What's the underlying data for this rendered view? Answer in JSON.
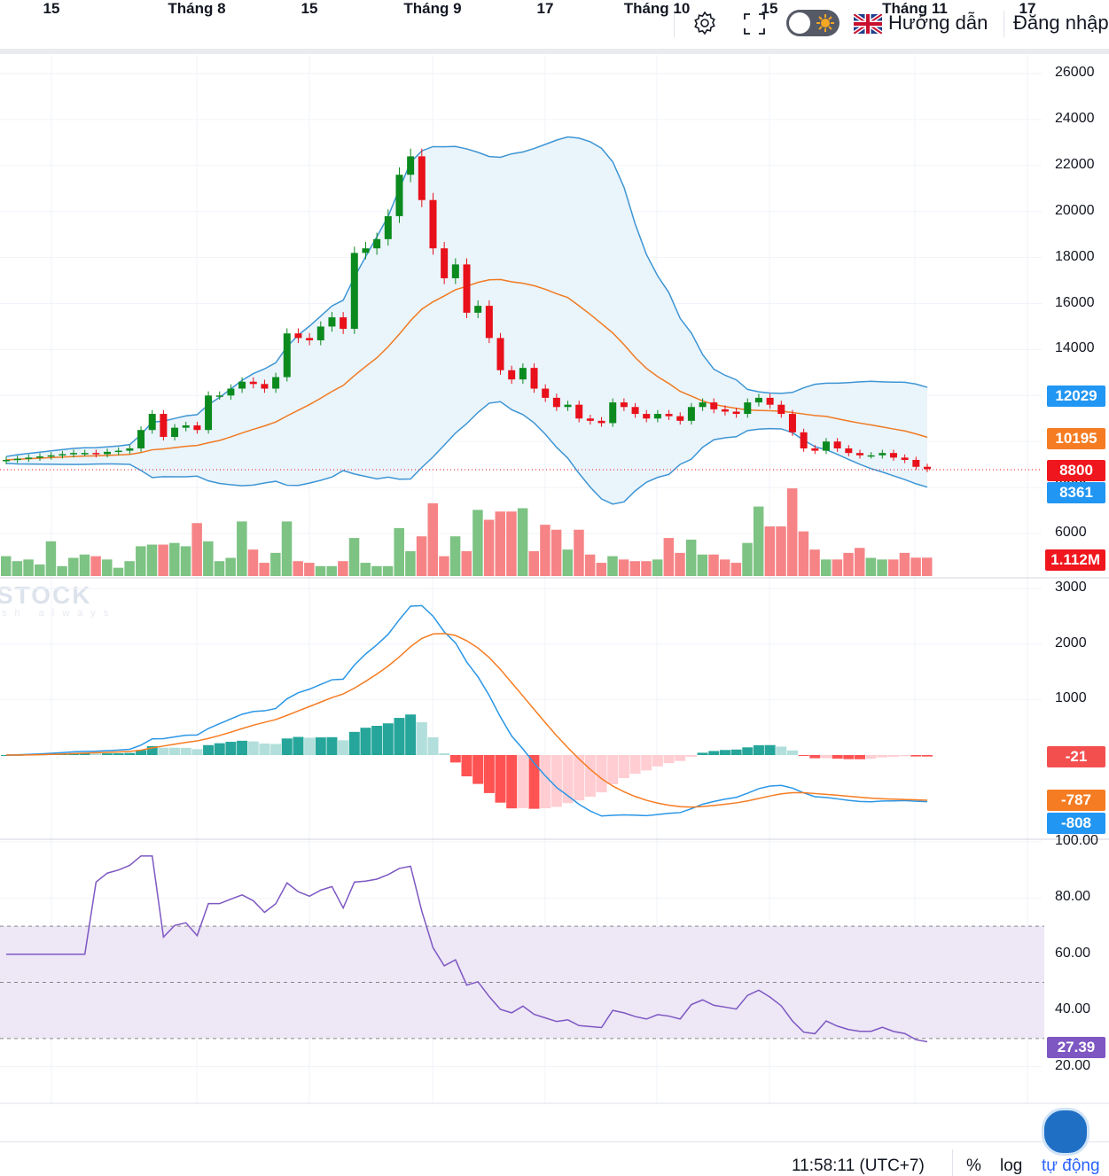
{
  "topbar": {
    "guide_label": "Hướng dẫn",
    "login_label": "Đăng nhập",
    "icons": [
      "gear-icon",
      "fullscreen-icon",
      "theme-toggle",
      "uk-flag-icon"
    ]
  },
  "watermark": {
    "brand": "STOCK",
    "tagline": "sh always"
  },
  "bottombar": {
    "time": "11:58:11 (UTC+7)",
    "percent": "%",
    "log": "log",
    "auto": "tự động"
  },
  "colors": {
    "up": "#0b8a1e",
    "down": "#e8101a",
    "vol_up": "#7dc383",
    "vol_down": "#f68486",
    "band": "#3d95d4",
    "band_fill": "#eaf4fb",
    "ma": "#f07a22",
    "macd": "#2a96e6",
    "signal": "#f57c22",
    "hist_up": "#26a69a",
    "hist_up_light": "#b2dfdb",
    "hist_down": "#ff5252",
    "hist_down_light": "#ffcdd2",
    "rsi": "#7e57c2",
    "rsi_fill": "#ede7f6"
  },
  "chart_data": {
    "type": "candlestick",
    "title": "",
    "x_tick_labels": [
      "15",
      "Tháng 8",
      "15",
      "Tháng 9",
      "17",
      "Tháng 10",
      "15",
      "Tháng 11",
      "17"
    ],
    "price": {
      "ylim": [
        5000,
        27000
      ],
      "y_ticks": [
        "26000",
        "24000",
        "22000",
        "20000",
        "18000",
        "16000",
        "14000",
        "12000",
        "10000",
        "8000",
        "6000"
      ],
      "first_open": 9150,
      "close": [
        9200,
        9250,
        9300,
        9350,
        9400,
        9450,
        9500,
        9500,
        9450,
        9550,
        9600,
        9700,
        10500,
        11200,
        10200,
        10600,
        10700,
        10500,
        12000,
        12000,
        12300,
        12600,
        12500,
        12300,
        12800,
        14700,
        14500,
        14400,
        15000,
        15400,
        14900,
        18200,
        18400,
        18800,
        19800,
        21600,
        22400,
        20500,
        18400,
        17100,
        17700,
        15600,
        15900,
        14500,
        13100,
        12700,
        13200,
        12300,
        11900,
        11500,
        11600,
        11000,
        10900,
        10800,
        11700,
        11500,
        11200,
        11000,
        11200,
        11100,
        10900,
        11500,
        11700,
        11400,
        11300,
        11200,
        11700,
        11900,
        11600,
        11200,
        10400,
        9700,
        9600,
        10000,
        9700,
        9500,
        9400,
        9400,
        9500,
        9300,
        9200,
        8900,
        8800
      ],
      "last_labels": {
        "bb_upper": "12029",
        "ma20": "10195",
        "close": "8800",
        "bb_lower": "8361"
      }
    },
    "volume": {
      "unit": "M",
      "values": [
        1.2,
        0.9,
        1.0,
        0.7,
        2.1,
        0.6,
        1.1,
        1.3,
        1.2,
        1.0,
        0.5,
        0.9,
        1.8,
        1.9,
        1.9,
        2.0,
        1.8,
        3.2,
        2.1,
        0.9,
        1.1,
        3.3,
        1.6,
        0.8,
        1.4,
        3.3,
        0.9,
        0.8,
        0.6,
        0.6,
        0.9,
        2.3,
        0.8,
        0.6,
        0.6,
        2.9,
        1.5,
        2.4,
        4.4,
        1.2,
        2.4,
        1.5,
        4.0,
        3.4,
        3.9,
        3.9,
        4.1,
        1.5,
        3.1,
        2.8,
        1.6,
        2.8,
        1.3,
        0.8,
        1.2,
        1.0,
        0.9,
        0.9,
        1.0,
        2.3,
        1.4,
        2.2,
        1.3,
        1.3,
        1.0,
        0.8,
        2.0,
        4.2,
        3.0,
        3.0,
        5.3,
        2.7,
        1.6,
        1.0,
        1.0,
        1.4,
        1.7,
        1.1,
        1.0,
        1.0,
        1.4,
        1.112,
        1.112
      ],
      "last_label": "1.112M"
    },
    "macd": {
      "ylim": [
        -1500,
        3100
      ],
      "y_ticks": [
        "3000",
        "2000",
        "1000"
      ],
      "params": [
        12,
        26,
        9
      ],
      "last_labels": {
        "histogram": "-21",
        "signal": "-787",
        "macd": "-808"
      }
    },
    "rsi": {
      "ylim": [
        12,
        100
      ],
      "y_ticks": [
        "100.00",
        "80.00",
        "60.00",
        "40.00",
        "20.00"
      ],
      "period": 14,
      "band": [
        30,
        70
      ],
      "last_label": "27.39"
    }
  }
}
